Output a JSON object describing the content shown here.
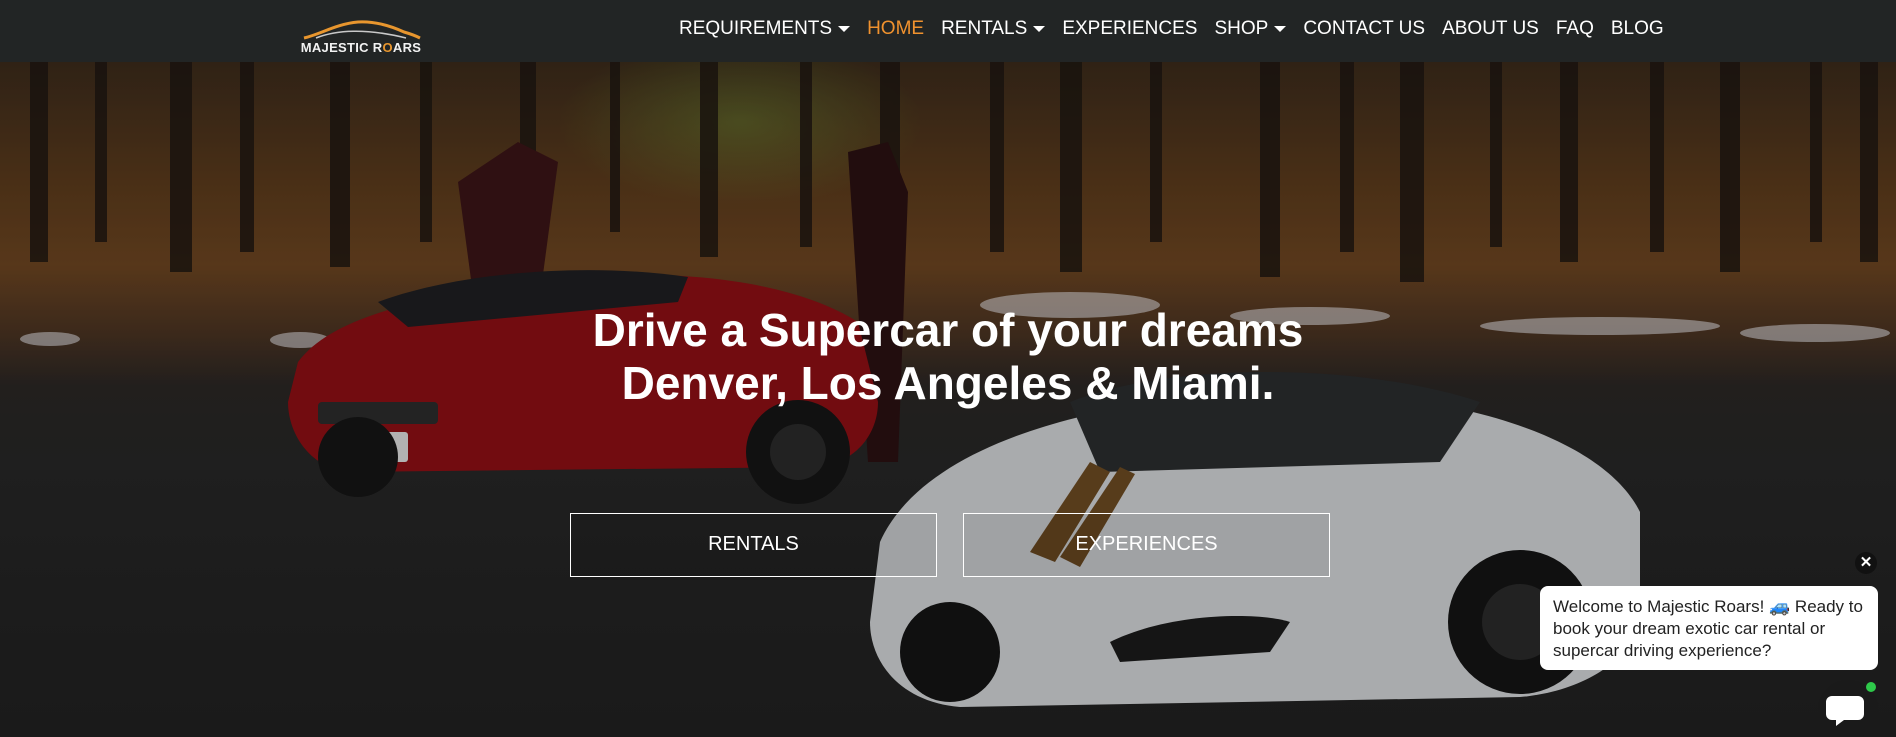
{
  "brand": {
    "logo_text_a": "MAJESTIC R",
    "logo_text_o": "O",
    "logo_text_b": "ARS",
    "accent_color": "#f0922e"
  },
  "nav": {
    "items": [
      {
        "label": "REQUIREMENTS",
        "has_dropdown": true,
        "active": false
      },
      {
        "label": "HOME",
        "has_dropdown": false,
        "active": true
      },
      {
        "label": "RENTALS",
        "has_dropdown": true,
        "active": false
      },
      {
        "label": "EXPERIENCES",
        "has_dropdown": false,
        "active": false
      },
      {
        "label": "SHOP",
        "has_dropdown": true,
        "active": false
      },
      {
        "label": "CONTACT US",
        "has_dropdown": false,
        "active": false
      },
      {
        "label": "ABOUT US",
        "has_dropdown": false,
        "active": false
      },
      {
        "label": "FAQ",
        "has_dropdown": false,
        "active": false
      },
      {
        "label": "BLOG",
        "has_dropdown": false,
        "active": false
      }
    ]
  },
  "hero": {
    "title_line1": "Drive a Supercar of your dreams",
    "title_line2": "Denver, Los Angeles & Miami.",
    "button_rentals": "RENTALS",
    "button_experiences": "EXPERIENCES"
  },
  "chat": {
    "close_icon": "close-icon",
    "message": "Welcome to Majestic Roars! 🚙 Ready to book your dream exotic car rental or supercar driving experience?",
    "launcher_icon": "chat-bubble-icon",
    "online_color": "#2ec94a"
  }
}
